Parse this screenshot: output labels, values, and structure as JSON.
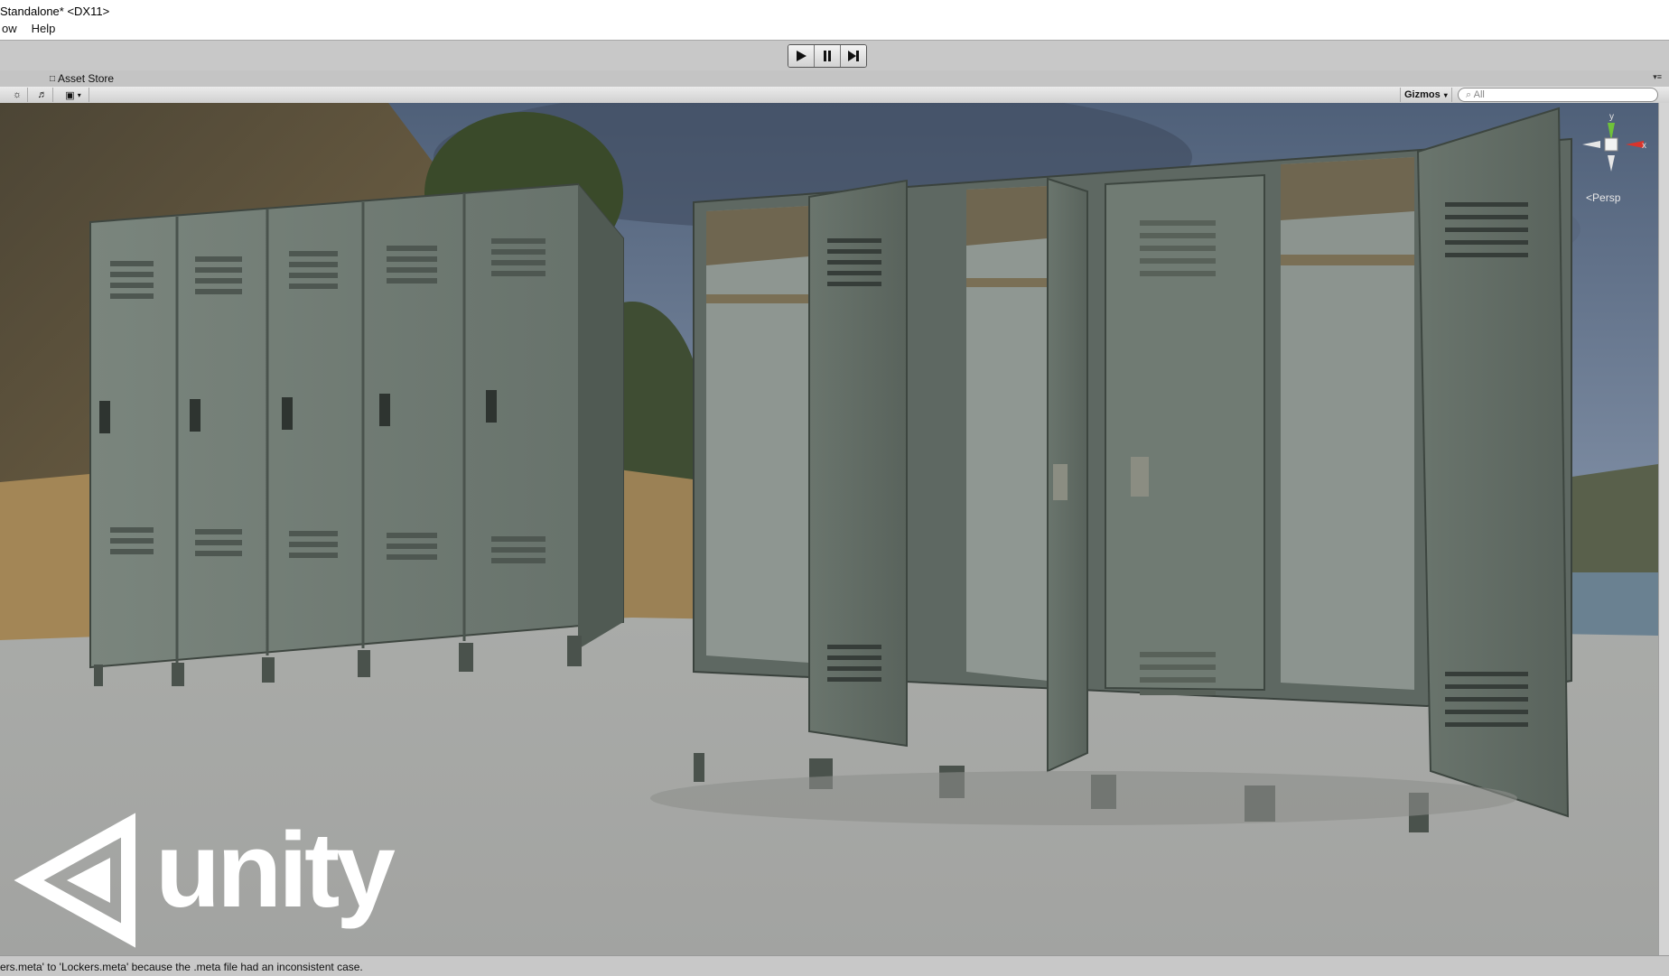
{
  "window": {
    "title": "Standalone* <DX11>"
  },
  "menu": {
    "items": [
      "ow",
      "Help"
    ]
  },
  "playback": {
    "play_icon": "play-icon",
    "pause_icon": "pause-icon",
    "step_icon": "step-icon"
  },
  "tabs": {
    "asset_store_label": "Asset Store"
  },
  "scene_toolbar": {
    "gizmos_label": "Gizmos",
    "search_placeholder": "All"
  },
  "viewport": {
    "gizmo_labels": {
      "y": "y",
      "x": "x"
    },
    "projection_label": "Persp",
    "logo_text": "unity"
  },
  "colors": {
    "sky": "#5d6f86",
    "floor": "#a4a6a3",
    "locker": "#6f7a72",
    "locker_dark": "#4e5751",
    "axis_y": "#6fc23a",
    "axis_x": "#d9342b"
  },
  "status": {
    "message": "ers.meta' to 'Lockers.meta' because the .meta file had an inconsistent case."
  }
}
